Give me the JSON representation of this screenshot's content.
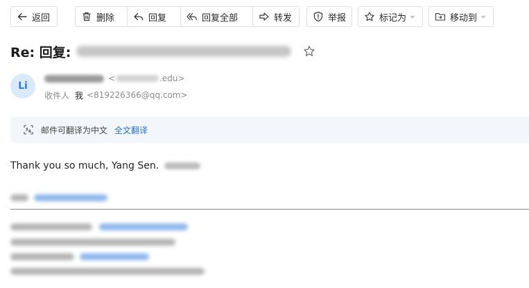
{
  "toolbar": {
    "back": "返回",
    "delete": "删除",
    "reply": "回复",
    "reply_all": "回复全部",
    "forward": "转发",
    "report": "举报",
    "mark_as": "标记为",
    "move_to": "移动到"
  },
  "email": {
    "subject_prefix": "Re: 回复:",
    "avatar_text": "Li",
    "sender_domain": ".edu>",
    "sender_addr_open": "<",
    "recipient_label": "收件人",
    "recipient_name": "我",
    "recipient_email": "<819226366@qq.com>"
  },
  "translate": {
    "notice": "邮件可翻译为中文",
    "action": "全文翻译"
  },
  "body": {
    "text": "Thank you so much, Yang Sen."
  },
  "icons": [
    "back-arrow-icon",
    "trash-icon",
    "reply-icon",
    "reply-all-icon",
    "forward-icon",
    "report-icon",
    "star-icon",
    "folder-move-icon",
    "translate-icon",
    "chevron-down-icon"
  ],
  "colors": {
    "link_blue": "#2b73c7",
    "avatar_bg": "#dbeafb",
    "avatar_text": "#2e7dd7",
    "translate_bar_bg": "#f3f6fa"
  }
}
